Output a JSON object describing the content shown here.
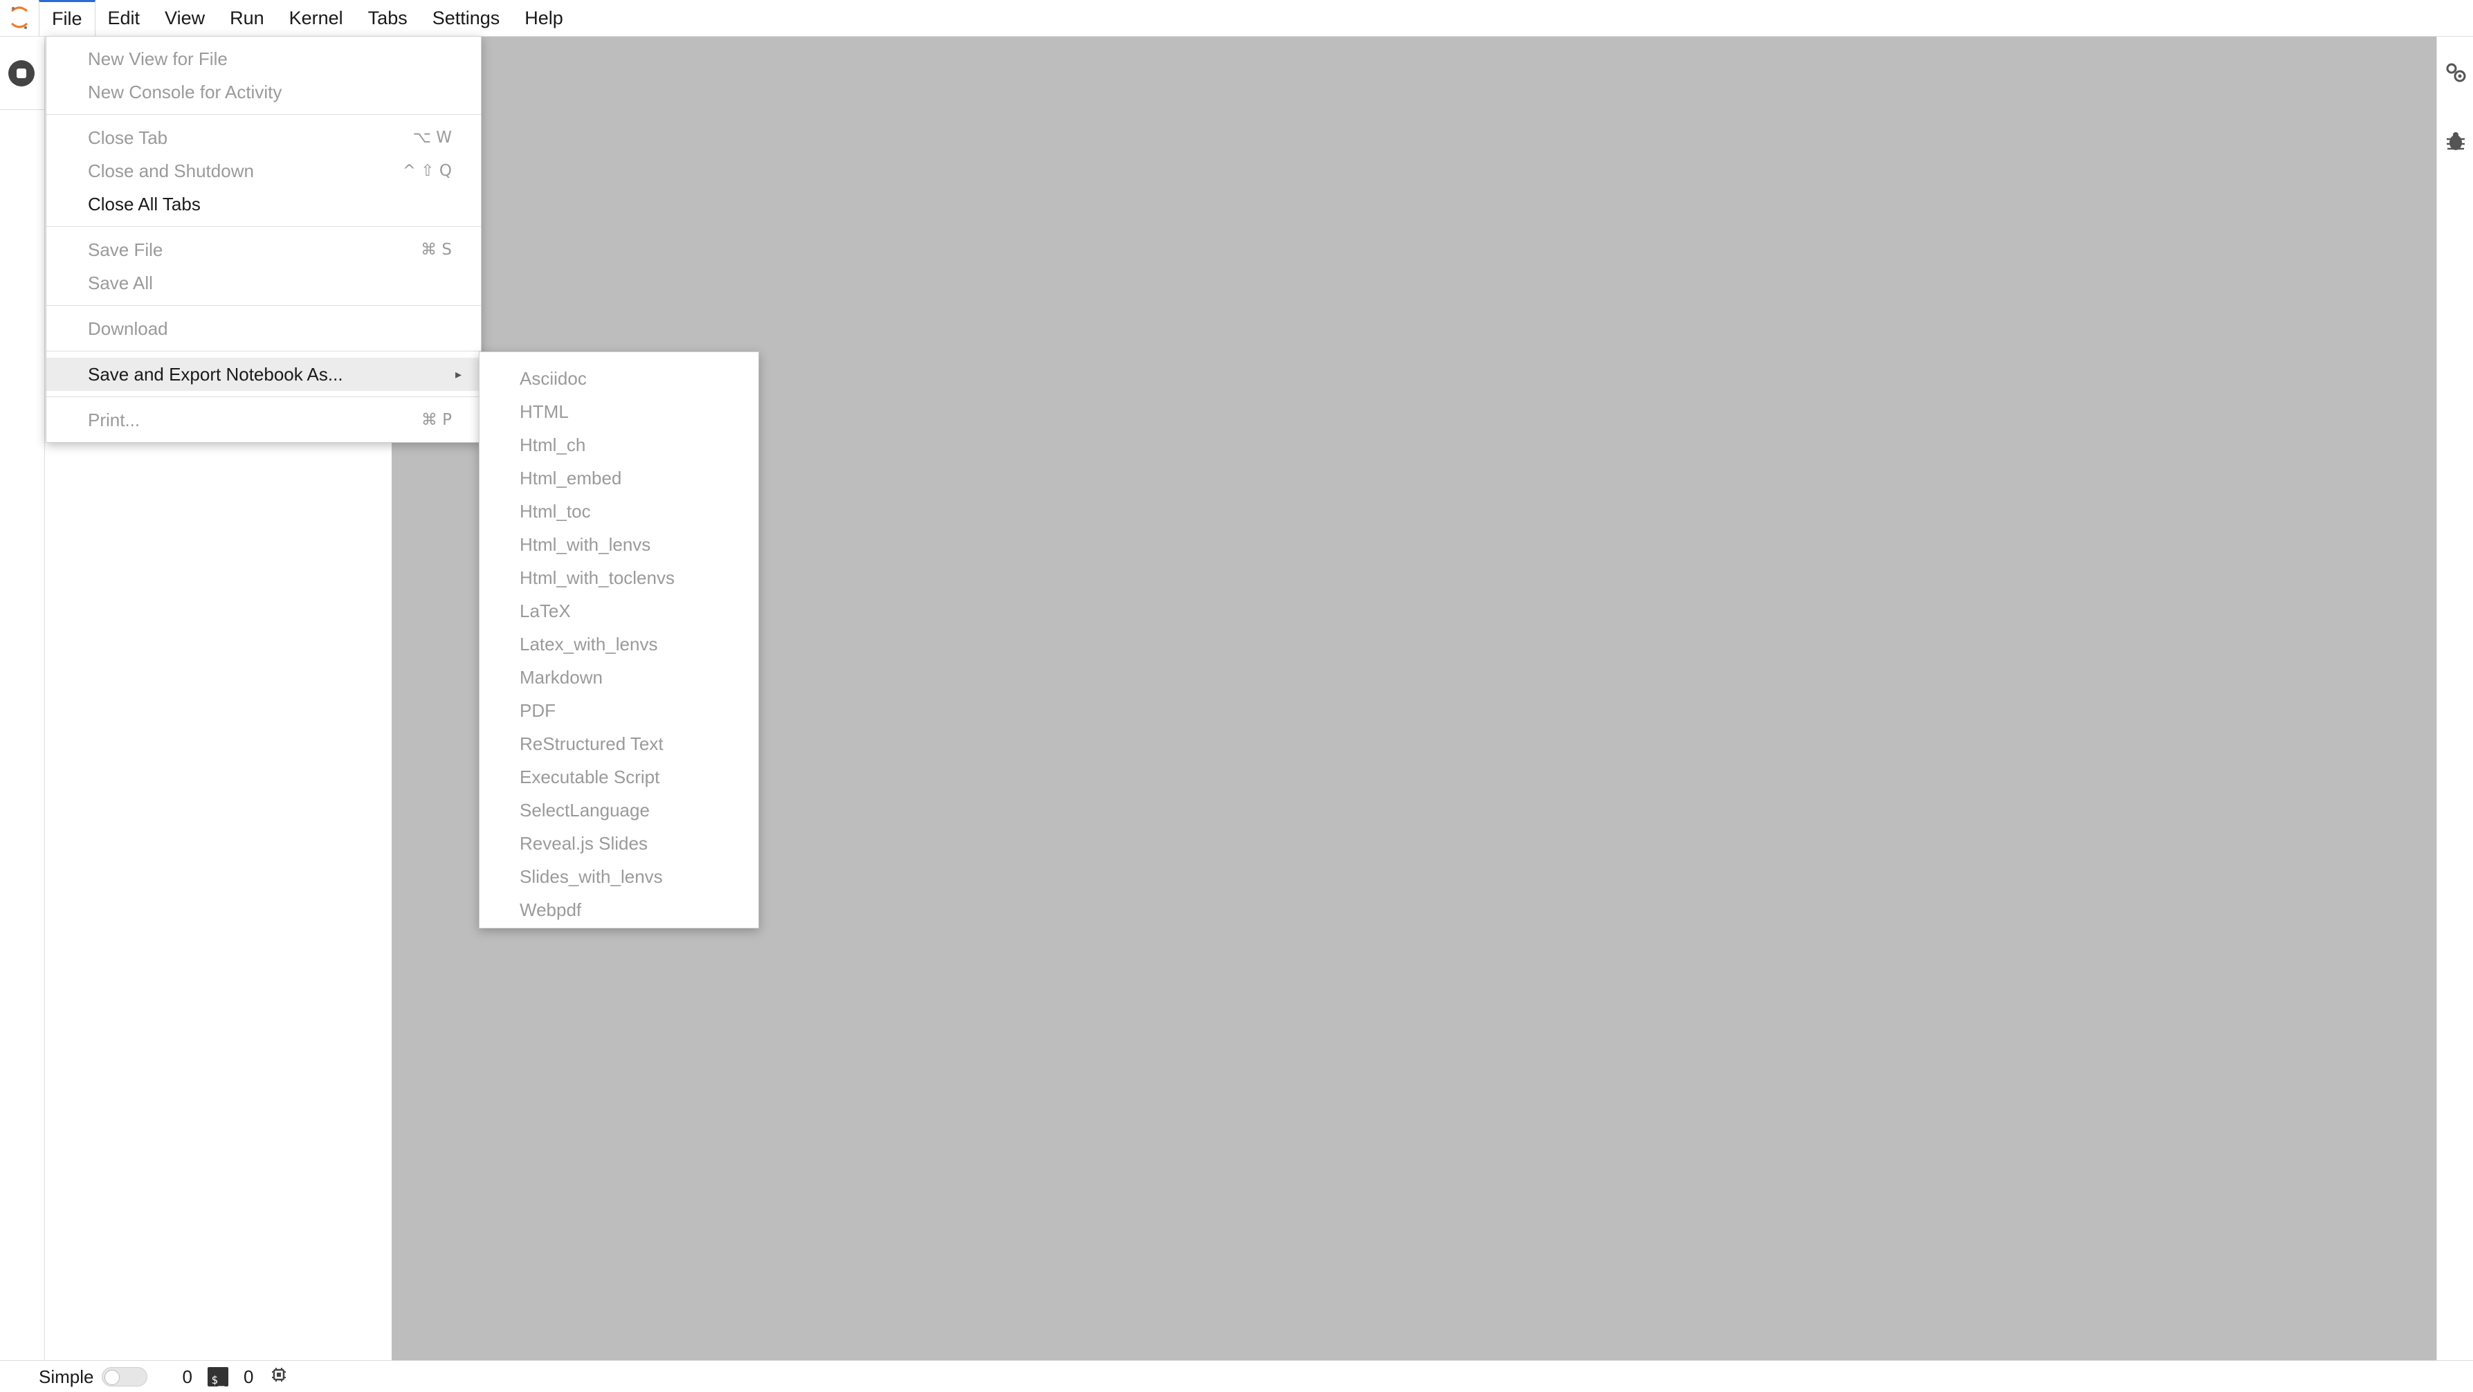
{
  "menubar": {
    "items": [
      "File",
      "Edit",
      "View",
      "Run",
      "Kernel",
      "Tabs",
      "Settings",
      "Help"
    ],
    "active": "File"
  },
  "file_menu": {
    "new_view": "New View for File",
    "new_console": "New Console for Activity",
    "close_tab": "Close Tab",
    "close_tab_shortcut": "⌥ W",
    "close_shutdown": "Close and Shutdown",
    "close_shutdown_shortcut": "^ ⇧ Q",
    "close_all": "Close All Tabs",
    "save_file": "Save File",
    "save_file_shortcut": "⌘ S",
    "save_all": "Save All",
    "download": "Download",
    "save_export": "Save and Export Notebook As...",
    "print": "Print...",
    "print_shortcut": "⌘ P"
  },
  "export_menu": {
    "items": [
      "Asciidoc",
      "HTML",
      "Html_ch",
      "Html_embed",
      "Html_toc",
      "Html_with_lenvs",
      "Html_with_toclenvs",
      "LaTeX",
      "Latex_with_lenvs",
      "Markdown",
      "PDF",
      "ReStructured Text",
      "Executable Script",
      "SelectLanguage",
      "Reveal.js Slides",
      "Slides_with_lenvs",
      "Webpdf"
    ]
  },
  "statusbar": {
    "mode_label": "Simple",
    "kernels_count": "0",
    "terminals_count": "0",
    "terminal_icon_text": "$_"
  },
  "colors": {
    "main_bg": "#bdbdbd",
    "accent": "#2c6bd6",
    "disabled_text": "#9a9a9a",
    "logo_orange": "#f37726"
  }
}
